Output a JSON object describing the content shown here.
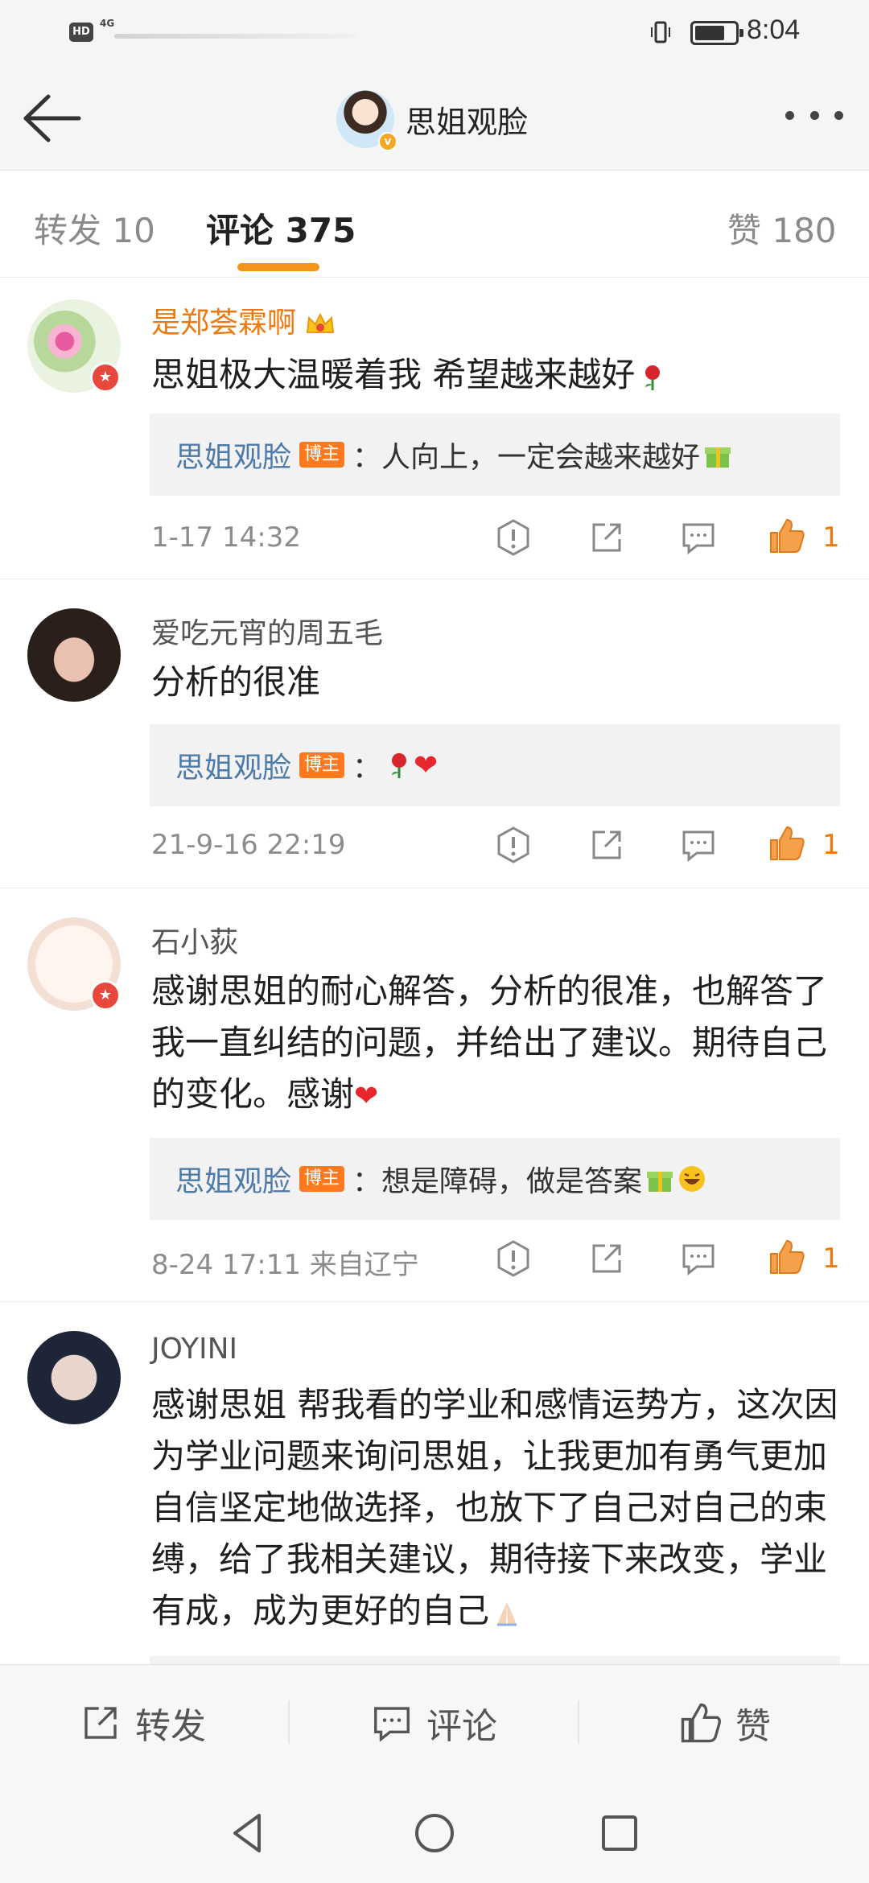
{
  "status_bar": {
    "network": "4G",
    "hd": "HD",
    "time": "8:04"
  },
  "header": {
    "title": "思姐观脸",
    "verified_mark": "v"
  },
  "tabs": [
    {
      "label": "转发 10"
    },
    {
      "label": "评论 375"
    },
    {
      "label": "赞 180"
    }
  ],
  "comments": [
    {
      "user": "是郑荟霖啊",
      "text": "思姐极大温暖着我  希望越来越好",
      "reply": {
        "author": "思姐观脸",
        "tag": "博主",
        "text": "：人向上，一定会越来越好"
      },
      "time": "1-17 14:32",
      "likes": "1"
    },
    {
      "user": "爱吃元宵的周五毛",
      "text": "分析的很准",
      "reply": {
        "author": "思姐观脸",
        "tag": "博主",
        "text": "："
      },
      "time": "21-9-16 22:19",
      "likes": "1"
    },
    {
      "user": "石小荻",
      "text": "感谢思姐的耐心解答，分析的很准，也解答了我一直纠结的问题，并给出了建议。期待自己的变化。感谢",
      "reply": {
        "author": "思姐观脸",
        "tag": "博主",
        "text": "：想是障碍，做是答案"
      },
      "time": "8-24 17:11 来自辽宁",
      "likes": "1"
    },
    {
      "user": "JOYINI",
      "text": "感谢思姐  帮我看的学业和感情运势方，这次因为学业问题来询问思姐，让我更加有勇气更加自信坚定地做选择，也放下了自己对自己的束缚，给了我相关建议，期待接下来改变，学业有成，成为更好的自己"
    }
  ],
  "bottom_bar": {
    "repost": "转发",
    "comment": "评论",
    "like": "赞"
  },
  "colors": {
    "accent": "#f5941d",
    "like": "#ec7a11",
    "reply_name": "#4d7aa8",
    "tag": "#ff7a1f"
  }
}
